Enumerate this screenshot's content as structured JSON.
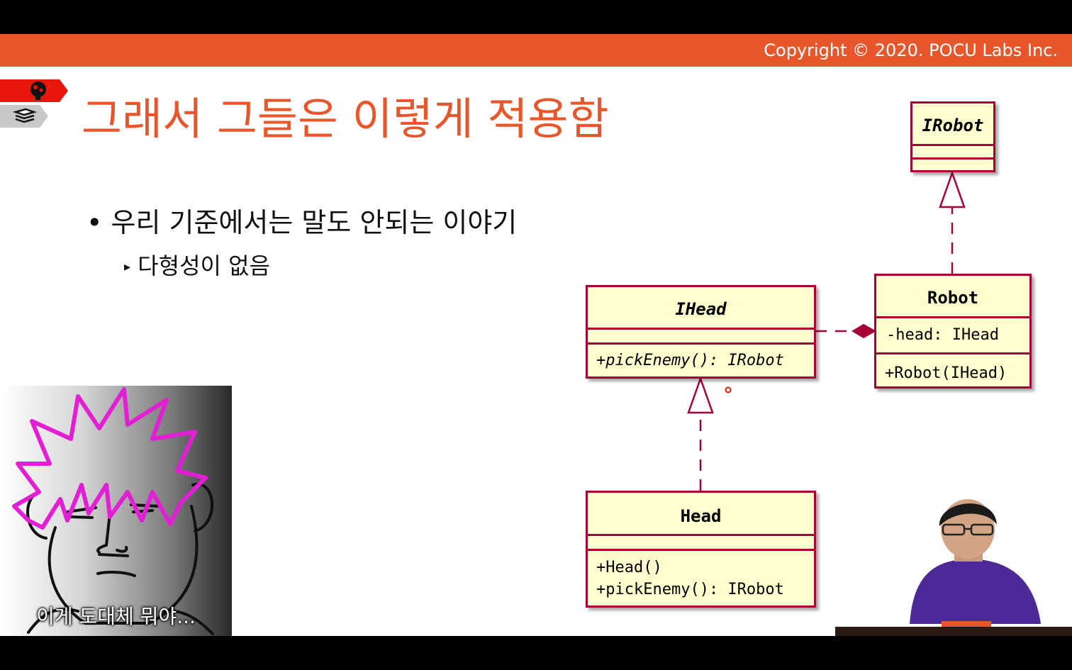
{
  "copyright": "Copyright © 2020. POCU Labs Inc.",
  "slide": {
    "title": "그래서 그들은 이렇게 적용함",
    "bullets": [
      {
        "text": "우리 기준에서는 말도 안되는 이야기"
      },
      {
        "text": "다형성이 없음"
      }
    ]
  },
  "diagram": {
    "classes": {
      "irobot": {
        "name": "IRobot",
        "fields": [],
        "methods": []
      },
      "robot": {
        "name": "Robot",
        "fields": [
          "-head: IHead"
        ],
        "methods": [
          "+Robot(IHead)"
        ]
      },
      "ihead": {
        "name": "IHead",
        "fields": [],
        "methods": [
          "+pickEnemy(): IRobot"
        ]
      },
      "head": {
        "name": "Head",
        "fields": [],
        "methods": [
          "+Head()",
          "+pickEnemy(): IRobot"
        ]
      }
    }
  },
  "cartoon": {
    "caption": "이게 도대체 뭐야..."
  },
  "colors": {
    "accent": "#e8572b",
    "uml_border": "#a80036",
    "uml_fill": "#fefece",
    "hair": "#e21fd4",
    "shirt": "#4b2996"
  }
}
